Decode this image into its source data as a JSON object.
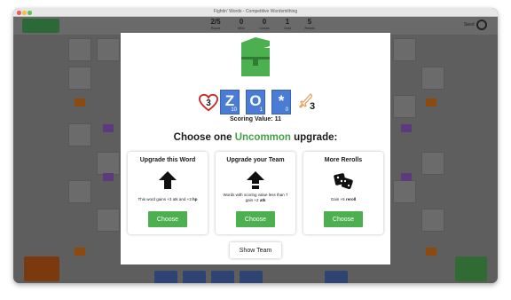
{
  "window": {
    "title": "Fightin' Words - Competitive Wordsmithing"
  },
  "stats": [
    {
      "value": "2/5",
      "label": "Round"
    },
    {
      "value": "0",
      "label": "Wins"
    },
    {
      "value": "0",
      "label": "Losses"
    },
    {
      "value": "1",
      "label": "Gold"
    },
    {
      "value": "5",
      "label": "Rerolls"
    }
  ],
  "seed_label": "Seed",
  "modal": {
    "hand": {
      "hp": "3",
      "tiles": [
        {
          "letter": "Z",
          "points": "10"
        },
        {
          "letter": "O",
          "points": "1"
        },
        {
          "letter": "*",
          "points": "0"
        }
      ],
      "atk": "3"
    },
    "scoring_value": "Scoring Value: 11",
    "heading": {
      "prefix": "Choose one ",
      "rarity": "Uncommon",
      "suffix": " upgrade:"
    },
    "cards": [
      {
        "title": "Upgrade this Word",
        "desc_plain": "This word gains +3 atk and +3 ",
        "desc_bold": "hp",
        "button": "Choose"
      },
      {
        "title": "Upgrade your Team",
        "desc_plain": "Words with scoring value less than 7 gain +2 ",
        "desc_bold": "atk",
        "button": "Choose"
      },
      {
        "title": "More Rerolls",
        "desc_plain": "Gain +5 ",
        "desc_bold": "reroll",
        "button": "Choose"
      }
    ],
    "show_team": "Show Team"
  },
  "colors": {
    "accent_green": "#4caf50",
    "tile_blue": "#4a7bd5",
    "heart_red": "#c62828",
    "sword_orange": "#e8a060",
    "rarity_green": "#43a047"
  }
}
